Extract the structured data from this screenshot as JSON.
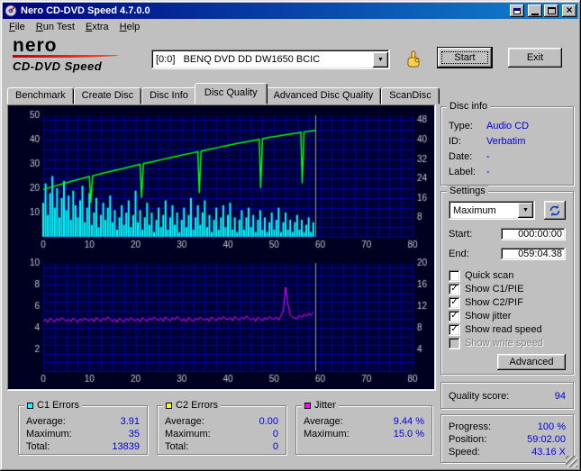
{
  "ui_colors": {
    "titlebar_start": "#000080",
    "titlebar_end": "#1084d0",
    "chart_panel_bg": "#000020",
    "chart_bg": "#000038",
    "chart_grid": "#0000a0",
    "value_text": "#0000dd"
  },
  "icons": {
    "close": "×",
    "dropdown": "▼",
    "check": "✓"
  },
  "window": {
    "title": "Nero CD-DVD Speed 4.7.0.0"
  },
  "menu": {
    "items": [
      "File",
      "Run Test",
      "Extra",
      "Help"
    ]
  },
  "logo": {
    "line1": "nero",
    "line2": "CD-DVD Speed"
  },
  "toolbar": {
    "drive_combo": "[0:0]   BENQ DVD DD DW1650 BCIC",
    "start_button": "Start",
    "exit_button": "Exit"
  },
  "tabs": {
    "items": [
      "Benchmark",
      "Create Disc",
      "Disc Info",
      "Disc Quality",
      "Advanced Disc Quality",
      "ScanDisc"
    ],
    "active": "Disc Quality"
  },
  "disc_info": {
    "title": "Disc info",
    "type_label": "Type:",
    "type_value": "Audio CD",
    "id_label": "ID:",
    "id_value": "Verbatim",
    "date_label": "Date:",
    "date_value": "-",
    "label_label": "Label:",
    "label_value": "-"
  },
  "settings": {
    "title": "Settings",
    "speed_combo": "Maximum",
    "start_label": "Start:",
    "start_value": "000:00:00",
    "end_label": "End:",
    "end_value": "059:04.38",
    "checkboxes": [
      {
        "label": "Quick scan",
        "checked": false,
        "disabled": false
      },
      {
        "label": "Show C1/PIE",
        "checked": true,
        "disabled": false
      },
      {
        "label": "Show C2/PIF",
        "checked": true,
        "disabled": false
      },
      {
        "label": "Show jitter",
        "checked": true,
        "disabled": false
      },
      {
        "label": "Show read speed",
        "checked": true,
        "disabled": false
      },
      {
        "label": "Show write speed",
        "checked": false,
        "disabled": true
      }
    ],
    "advanced_button": "Advanced"
  },
  "quality": {
    "label": "Quality score:",
    "value": "94"
  },
  "progress": {
    "progress_label": "Progress:",
    "progress_value": "100 %",
    "position_label": "Position:",
    "position_value": "59:02.00",
    "speed_label": "Speed:",
    "speed_value": "43.16 X"
  },
  "stats": [
    {
      "title": "C1 Errors",
      "color": "#00ffff",
      "rows": [
        {
          "label": "Average:",
          "value": "3.91"
        },
        {
          "label": "Maximum:",
          "value": "35"
        },
        {
          "label": "Total:",
          "value": "13839"
        }
      ]
    },
    {
      "title": "C2 Errors",
      "color": "#ffff00",
      "rows": [
        {
          "label": "Average:",
          "value": "0.00"
        },
        {
          "label": "Maximum:",
          "value": "0"
        },
        {
          "label": "Total:",
          "value": "0"
        }
      ]
    },
    {
      "title": "Jitter",
      "color": "#ff00ff",
      "rows": [
        {
          "label": "Average:",
          "value": "9.44 %"
        },
        {
          "label": "Maximum:",
          "value": "15.0 %"
        }
      ]
    }
  ],
  "chart_data": [
    {
      "type": "line",
      "title": "C1 errors and read speed",
      "xlim": [
        0,
        80
      ],
      "x_ticks": [
        0,
        10,
        20,
        30,
        40,
        50,
        60,
        70,
        80
      ],
      "ylim_left": [
        0,
        50
      ],
      "yticks_left": [
        10,
        20,
        30,
        40,
        50
      ],
      "ylim_right": [
        0,
        50
      ],
      "yticks_right": [
        8,
        16,
        24,
        32,
        40,
        48
      ],
      "grid_x": 2.5,
      "grid_y": 4,
      "data_end_x": 59,
      "series": [
        {
          "name": "C1 errors",
          "color": "#00ffff",
          "style": "impulse",
          "axis": "left",
          "x_start": 0,
          "x_step": 0.5,
          "values": [
            14,
            22,
            9,
            18,
            25,
            12,
            20,
            8,
            16,
            23,
            11,
            17,
            7,
            19,
            13,
            8,
            15,
            21,
            6,
            12,
            18,
            5,
            10,
            16,
            4,
            9,
            14,
            7,
            12,
            17,
            6,
            11,
            3,
            8,
            13,
            5,
            10,
            15,
            4,
            9,
            19,
            6,
            11,
            3,
            8,
            14,
            5,
            10,
            2,
            7,
            12,
            4,
            9,
            15,
            3,
            8,
            13,
            5,
            10,
            2,
            7,
            12,
            4,
            9,
            16,
            3,
            8,
            13,
            5,
            10,
            15,
            4,
            9,
            2,
            7,
            12,
            3,
            8,
            13,
            4,
            9,
            14,
            3,
            8,
            2,
            7,
            11,
            3,
            8,
            12,
            4,
            9,
            2,
            7,
            11,
            3,
            8,
            2,
            6,
            10,
            3,
            7,
            12,
            2,
            6,
            10,
            3,
            7,
            2,
            6,
            9,
            3,
            7,
            2,
            5,
            8,
            2,
            6
          ]
        },
        {
          "name": "Read speed (X)",
          "color": "#00ff00",
          "style": "line",
          "axis": "left",
          "width": 1.5,
          "points": [
            [
              0,
              19.5
            ],
            [
              2,
              20.6
            ],
            [
              4,
              21.7
            ],
            [
              6,
              22.8
            ],
            [
              8,
              23.8
            ],
            [
              10,
              24.8
            ],
            [
              10.3,
              14
            ],
            [
              10.7,
              25.1
            ],
            [
              13,
              26.2
            ],
            [
              15,
              27.1
            ],
            [
              17,
              28.0
            ],
            [
              19,
              28.9
            ],
            [
              21,
              29.8
            ],
            [
              21.3,
              16
            ],
            [
              21.7,
              30.1
            ],
            [
              24,
              31.0
            ],
            [
              26,
              31.9
            ],
            [
              28,
              32.8
            ],
            [
              30,
              33.6
            ],
            [
              32,
              34.4
            ],
            [
              33.5,
              35.0
            ],
            [
              33.8,
              18
            ],
            [
              34.2,
              35.2
            ],
            [
              36,
              36.0
            ],
            [
              38,
              36.8
            ],
            [
              40,
              37.6
            ],
            [
              42,
              38.4
            ],
            [
              44,
              39.1
            ],
            [
              46,
              39.8
            ],
            [
              46.8,
              40.1
            ],
            [
              47.1,
              20
            ],
            [
              47.5,
              40.3
            ],
            [
              49,
              40.9
            ],
            [
              51,
              41.5
            ],
            [
              53,
              42.1
            ],
            [
              55,
              42.7
            ],
            [
              55.8,
              43.0
            ],
            [
              56.1,
              22
            ],
            [
              56.5,
              43.1
            ],
            [
              58,
              43.5
            ],
            [
              59,
              43.7
            ]
          ]
        }
      ]
    },
    {
      "type": "line",
      "title": "Jitter",
      "xlim": [
        0,
        80
      ],
      "x_ticks": [
        0,
        10,
        20,
        30,
        40,
        50,
        60,
        70,
        80
      ],
      "ylim_left": [
        0,
        10
      ],
      "yticks_left": [
        2,
        4,
        6,
        8,
        10
      ],
      "ylim_right": [
        0,
        20
      ],
      "yticks_right": [
        4,
        8,
        12,
        16,
        20
      ],
      "grid_x": 2.5,
      "grid_y": 0.8,
      "data_end_x": 59,
      "series": [
        {
          "name": "Jitter (%)",
          "color": "#ff00ff",
          "style": "line",
          "axis": "right",
          "width": 1,
          "x_start": 0,
          "x_step": 0.5,
          "values": [
            9.2,
            9.6,
            9.0,
            9.8,
            9.4,
            9.1,
            9.7,
            9.3,
            9.9,
            9.5,
            9.2,
            9.6,
            9.1,
            9.8,
            9.4,
            9.0,
            9.7,
            9.3,
            9.8,
            9.5,
            9.3,
            9.7,
            9.1,
            9.9,
            9.5,
            9.2,
            9.8,
            9.4,
            10.0,
            9.6,
            9.2,
            9.6,
            9.0,
            9.8,
            9.4,
            9.1,
            9.7,
            9.3,
            9.9,
            9.5,
            9.3,
            9.7,
            9.1,
            9.9,
            9.5,
            9.2,
            9.8,
            9.4,
            10.0,
            9.6,
            9.4,
            9.8,
            9.2,
            10.0,
            9.6,
            9.3,
            9.9,
            9.5,
            10.1,
            9.7,
            9.3,
            9.7,
            9.1,
            9.9,
            9.5,
            9.2,
            9.8,
            9.4,
            10.0,
            9.6,
            9.4,
            9.8,
            9.2,
            10.0,
            9.6,
            9.3,
            9.9,
            9.5,
            10.1,
            9.7,
            9.5,
            9.9,
            9.3,
            10.1,
            9.7,
            9.4,
            10.0,
            9.6,
            10.2,
            9.8,
            9.4,
            9.8,
            9.2,
            10.0,
            9.6,
            9.3,
            9.9,
            9.5,
            10.1,
            9.7,
            9.6,
            10.0,
            9.4,
            10.2,
            11.2,
            15.5,
            12.4,
            10.4,
            10.0,
            9.8,
            9.7,
            10.3,
            9.9,
            10.5,
            10.1,
            10.7,
            10.3,
            10.9
          ]
        }
      ]
    }
  ]
}
